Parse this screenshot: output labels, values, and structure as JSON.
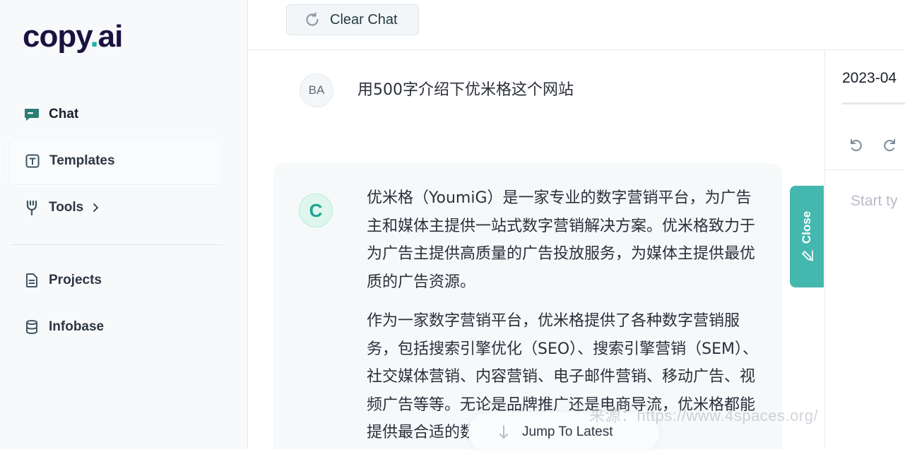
{
  "brand": {
    "logo_main": "copy",
    "logo_dot": ".",
    "logo_tail": "ai"
  },
  "sidebar": {
    "items": [
      {
        "label": "Chat",
        "icon": "chat-bubble-icon"
      },
      {
        "label": "Templates",
        "icon": "template-icon"
      },
      {
        "label": "Tools",
        "icon": "tools-icon"
      },
      {
        "label": "Projects",
        "icon": "document-icon"
      },
      {
        "label": "Infobase",
        "icon": "database-icon"
      }
    ]
  },
  "header": {
    "clear_label": "Clear Chat"
  },
  "chat": {
    "user_initials": "BA",
    "user_message": "用500字介绍下优米格这个网站",
    "ai_initial": "C",
    "ai_paragraphs": [
      "优米格（YoumiG）是一家专业的数字营销平台，为广告主和媒体主提供一站式数字营销解决方案。优米格致力于为广告主提供高质量的广告投放服务，为媒体主提供最优质的广告资源。",
      "作为一家数字营销平台，优米格提供了各种数字营销服务，包括搜索引擎优化（SEO）、搜索引擎营销（SEM）、社交媒体营销、内容营销、电子邮件营销、移动广告、视频广告等等。无论是品牌推广还是电商导流，优米格都能提供最合适的数字营销方"
    ],
    "jump_label": "Jump To Latest"
  },
  "watermark": "来源：https://www.4spaces.org/",
  "close_tab": {
    "label": "Close"
  },
  "right_panel": {
    "date": "2023-04",
    "editor_placeholder": "Start ty"
  },
  "colors": {
    "brand_teal": "#1fb3a5",
    "close_tab_bg": "#44b7ae",
    "logo_navy": "#1a1240"
  }
}
